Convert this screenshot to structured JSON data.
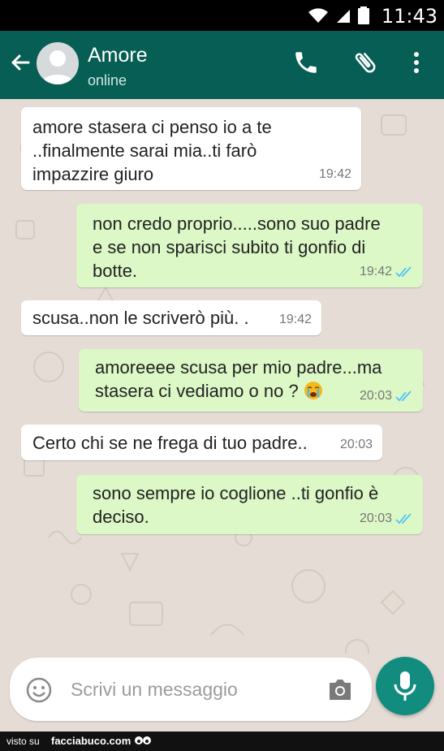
{
  "status_bar": {
    "time": "11:43"
  },
  "header": {
    "contact_name": "Amore",
    "status": "online"
  },
  "messages": [
    {
      "direction": "incoming",
      "text": "amore stasera ci penso io a te\n..finalmente sarai mia..ti farò\nimpazzire giuro",
      "time": "19:42"
    },
    {
      "direction": "outgoing",
      "text": "non credo proprio.....sono suo padre\ne se non sparisci subito ti gonfio di\nbotte.",
      "time": "19:42",
      "read": true
    },
    {
      "direction": "incoming",
      "text": "scusa..non le scriverò più. .",
      "time": "19:42"
    },
    {
      "direction": "outgoing",
      "text_line1": "amoreeee scusa per mio padre...ma",
      "text_line2": "stasera ci vediamo o no ?",
      "emoji": "crying-face",
      "time": "20:03",
      "read": true
    },
    {
      "direction": "incoming",
      "text": "Certo chi se ne frega di tuo padre..",
      "time": "20:03"
    },
    {
      "direction": "outgoing",
      "text": "sono sempre io coglione ..ti gonfio è\ndeciso.",
      "time": "20:03",
      "read": true
    }
  ],
  "composer": {
    "placeholder": "Scrivi un messaggio"
  },
  "watermark": {
    "prefix": "visto su",
    "site": "facciabuco.com"
  },
  "colors": {
    "header": "#075e54",
    "outgoing_bubble": "#dcf8c6",
    "incoming_bubble": "#ffffff",
    "accent": "#128c7e",
    "read_check": "#4fc3f7"
  }
}
